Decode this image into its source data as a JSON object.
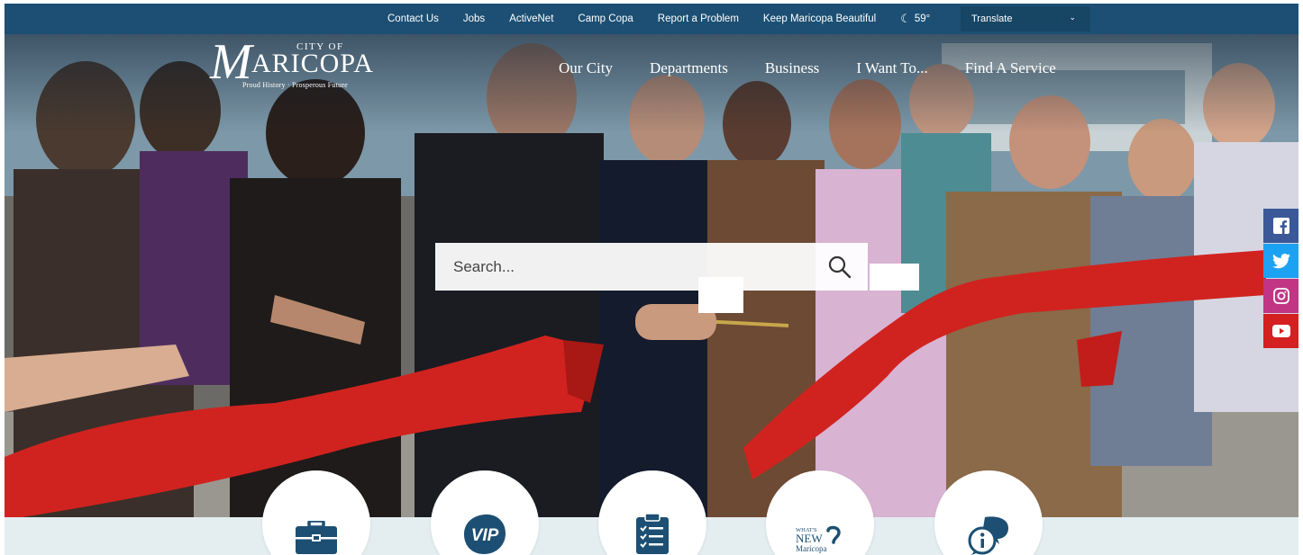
{
  "utility_bar": {
    "links": [
      "Contact Us",
      "Jobs",
      "ActiveNet",
      "Camp Copa",
      "Report a Problem",
      "Keep Maricopa Beautiful"
    ],
    "weather": {
      "icon": "moon-icon",
      "temperature": "59°"
    },
    "translate_label": "Translate"
  },
  "logo": {
    "city_of": "CITY OF",
    "initial": "M",
    "name_rest": "ARICOPA",
    "tagline": "Proud History · Prosperous Future"
  },
  "main_nav": [
    "Our City",
    "Departments",
    "Business",
    "I Want To...",
    "Find A Service"
  ],
  "search": {
    "placeholder": "Search..."
  },
  "social": [
    "facebook-icon",
    "twitter-icon",
    "instagram-icon",
    "youtube-icon"
  ],
  "quick_links": [
    {
      "icon": "briefcase-icon"
    },
    {
      "icon": "vip-portal-icon",
      "text": "VIP"
    },
    {
      "icon": "checklist-icon"
    },
    {
      "icon": "whats-new-icon",
      "line1": "WHAT'S",
      "line2": "NEW",
      "line3": "Maricopa"
    },
    {
      "icon": "info-chat-icon"
    }
  ],
  "colors": {
    "utility_bar": "#1c4f73",
    "accent": "#1c4f73",
    "facebook": "#3b5998",
    "twitter": "#1da1f2",
    "instagram": "#c13584",
    "youtube": "#d42020",
    "ribbon": "#d0231f"
  }
}
